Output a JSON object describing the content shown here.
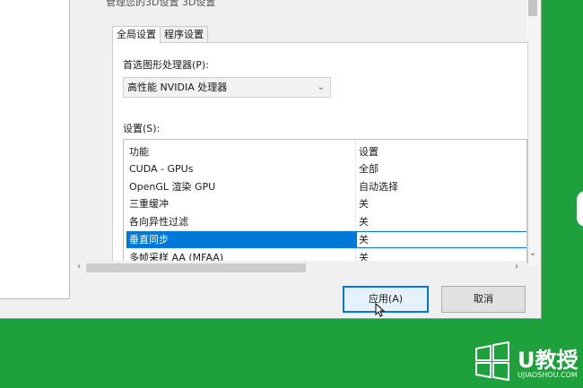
{
  "dialog": {
    "header_text": "管理您的3D设置 3D设置"
  },
  "tabs": [
    {
      "label": "全局设置",
      "active": true
    },
    {
      "label": "程序设置",
      "active": false
    }
  ],
  "preferred_gpu": {
    "label": "首选图形处理器(P):",
    "value": "高性能 NVIDIA 处理器"
  },
  "settings": {
    "label": "设置(S):",
    "columns": [
      "功能",
      "设置"
    ],
    "rows": [
      {
        "feature": "CUDA - GPUs",
        "value": "全部"
      },
      {
        "feature": "OpenGL 渲染 GPU",
        "value": "自动选择"
      },
      {
        "feature": "三重缓冲",
        "value": "关"
      },
      {
        "feature": "各向异性过滤",
        "value": "关"
      },
      {
        "feature": "垂直同步",
        "value": "关",
        "selected": true
      },
      {
        "feature": "多帧采样 AA (MFAA)",
        "value": "关"
      }
    ]
  },
  "buttons": {
    "apply": "应用(A)",
    "cancel": "取消"
  },
  "watermark": {
    "brand": "U教授",
    "url": "UJIAOSHOU.COM"
  },
  "colors": {
    "background": "#1ea03c",
    "selection": "#0078d7"
  }
}
